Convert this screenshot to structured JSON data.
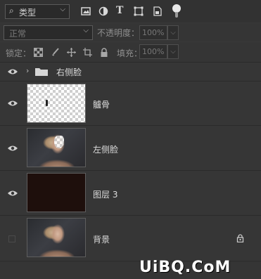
{
  "filter": {
    "icon": "search-icon",
    "kind_label": "类型",
    "icons": [
      "image-filter-icon",
      "adjustment-filter-icon",
      "type-filter-icon",
      "shape-filter-icon",
      "smart-object-filter-icon"
    ]
  },
  "blend": {
    "mode": "正常",
    "opacity_label": "不透明度：",
    "opacity_value": "100%"
  },
  "lock": {
    "label": "锁定：",
    "icons": [
      "lock-transparent-icon",
      "lock-image-icon",
      "lock-position-icon",
      "lock-artboard-icon",
      "lock-all-icon"
    ],
    "fill_label": "填充：",
    "fill_value": "100%"
  },
  "layers": [
    {
      "name": "右侧脸",
      "type": "group",
      "visible": true
    },
    {
      "name": "髗骨",
      "type": "layer",
      "thumbnail": "transparent",
      "visible": true
    },
    {
      "name": "左侧脸",
      "type": "layer",
      "thumbnail": "photo",
      "visible": true
    },
    {
      "name": "图层 3",
      "type": "layer",
      "thumbnail": "solid-dark",
      "visible": true
    },
    {
      "name": "背景",
      "type": "background",
      "thumbnail": "photo",
      "visible": false,
      "locked": true
    }
  ],
  "watermark": "UiBQ.CoM",
  "colors": {
    "panel_bg": "#363636",
    "layer3_fill": "#1e0f0c"
  }
}
